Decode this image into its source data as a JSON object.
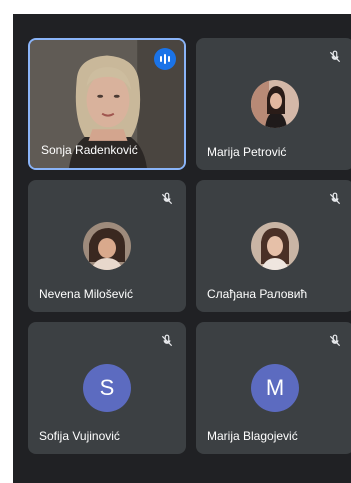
{
  "participants": [
    {
      "name": "Sonja Radenković",
      "status": "speaking",
      "avatar_type": "video"
    },
    {
      "name": "Marija Petrović",
      "status": "muted",
      "avatar_type": "photo"
    },
    {
      "name": "Nevena Milošević",
      "status": "muted",
      "avatar_type": "photo"
    },
    {
      "name": "Слађана Раловић",
      "status": "muted",
      "avatar_type": "photo"
    },
    {
      "name": "Sofija Vujinović",
      "status": "muted",
      "avatar_type": "letter",
      "initial": "S",
      "avatar_color": "#5c6bc0"
    },
    {
      "name": "Marija Blagojević",
      "status": "muted",
      "avatar_type": "letter",
      "initial": "M",
      "avatar_color": "#5c6bc0"
    }
  ],
  "colors": {
    "background": "#202124",
    "tile": "#3c4043",
    "active_border": "#8ab4f8",
    "speaking_badge": "#1a73e8"
  },
  "icons": {
    "speaking": "audio-level-icon",
    "muted": "mic-off-icon"
  }
}
